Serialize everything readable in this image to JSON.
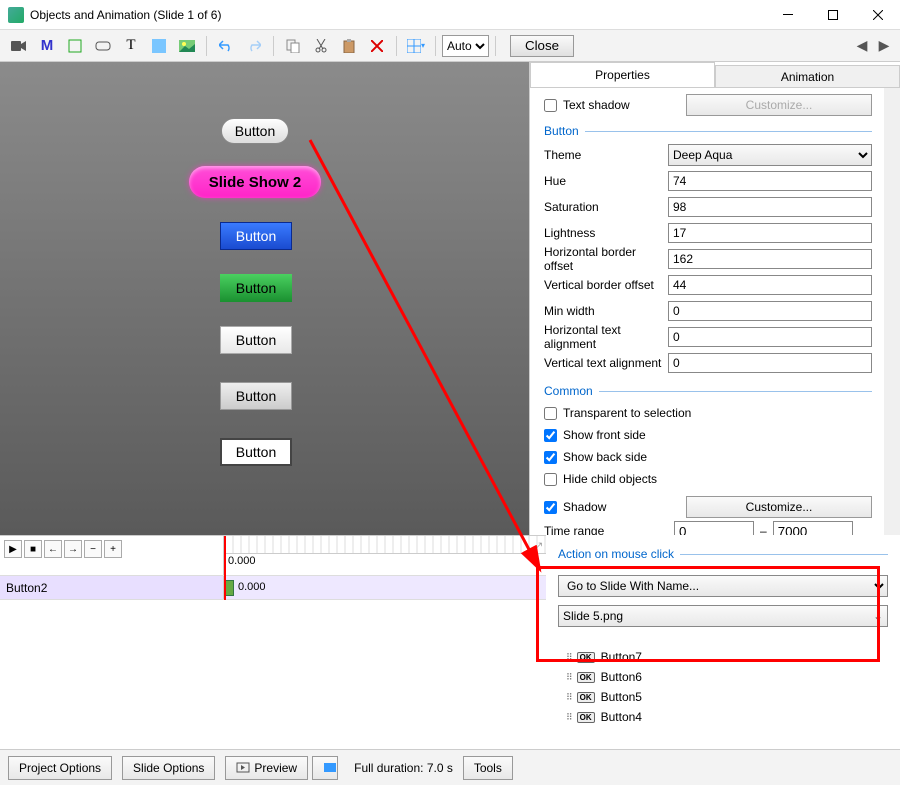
{
  "window": {
    "title": "Objects and Animation (Slide 1 of 6)"
  },
  "toolbar": {
    "zoom": "Auto",
    "close": "Close"
  },
  "tabs": {
    "properties": "Properties",
    "animation": "Animation"
  },
  "canvas": {
    "buttons": {
      "b1": "Button",
      "b2": "Slide Show 2",
      "b3": "Button",
      "b4": "Button",
      "b5": "Button",
      "b6": "Button",
      "b7": "Button"
    }
  },
  "props": {
    "text_shadow": "Text shadow",
    "customize_disabled": "Customize...",
    "button_section": "Button",
    "theme_label": "Theme",
    "theme_value": "Deep Aqua",
    "hue_label": "Hue",
    "hue": "74",
    "sat_label": "Saturation",
    "sat": "98",
    "light_label": "Lightness",
    "light": "17",
    "hbo_label": "Horizontal border offset",
    "hbo": "162",
    "vbo_label": "Vertical border offset",
    "vbo": "44",
    "minw_label": "Min width",
    "minw": "0",
    "hta_label": "Horizontal text alignment",
    "hta": "0",
    "vta_label": "Vertical text alignment",
    "vta": "0",
    "common_section": "Common",
    "transparent": "Transparent to selection",
    "front": "Show front side",
    "back": "Show back side",
    "hide": "Hide child objects",
    "shadow": "Shadow",
    "customize": "Customize...",
    "timerange_label": "Time range",
    "tr_from": "0",
    "tr_dash": "–",
    "tr_to": "7000",
    "action_section": "Action on mouse click",
    "action_value": "Go to Slide With Name...",
    "slide_value": "Slide 5.png"
  },
  "objects": {
    "items": [
      "Button7",
      "Button6",
      "Button5",
      "Button4"
    ]
  },
  "timeline": {
    "zero": "0.000",
    "layer_name": "Button2",
    "kf": "0.000"
  },
  "bottom": {
    "project_options": "Project Options",
    "slide_options": "Slide Options",
    "preview": "Preview",
    "duration": "Full duration: 7.0 s",
    "tools": "Tools"
  }
}
